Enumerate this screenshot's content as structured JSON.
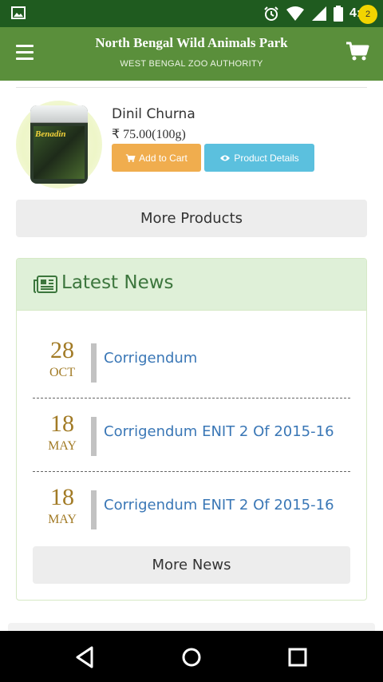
{
  "status_bar": {
    "time": "4:45",
    "icons": [
      "image-icon",
      "alarm-icon",
      "wifi-icon",
      "signal-icon",
      "battery-icon"
    ]
  },
  "app_bar": {
    "title": "North Bengal Wild Animals Park",
    "subtitle": "WEST BENGAL ZOO AUTHORITY",
    "cart_count": "2"
  },
  "product": {
    "name": "Dinil Churna",
    "price": "₹ 75.00(100g)",
    "image_label": "Benadin",
    "add_to_cart_label": "Add to Cart",
    "details_label": "Product Details"
  },
  "more_products_label": "More Products",
  "news": {
    "title": "Latest News",
    "items": [
      {
        "day": "28",
        "month": "OCT",
        "title": "Corrigendum"
      },
      {
        "day": "18",
        "month": "MAY",
        "title": "Corrigendum ENIT 2 Of 2015-16"
      },
      {
        "day": "18",
        "month": "MAY",
        "title": "Corrigendum ENIT 2 Of 2015-16"
      }
    ],
    "more_label": "More News"
  },
  "colors": {
    "status_bar": "#1f5b1f",
    "app_bar": "#5a8f3b",
    "cart_badge": "#f2d400",
    "add_to_cart": "#f0ad4e",
    "details": "#5bc0de",
    "news_header": "#dff0d8",
    "news_title": "#3c763d",
    "date": "#a27b26",
    "news_link": "#3a77b6"
  }
}
